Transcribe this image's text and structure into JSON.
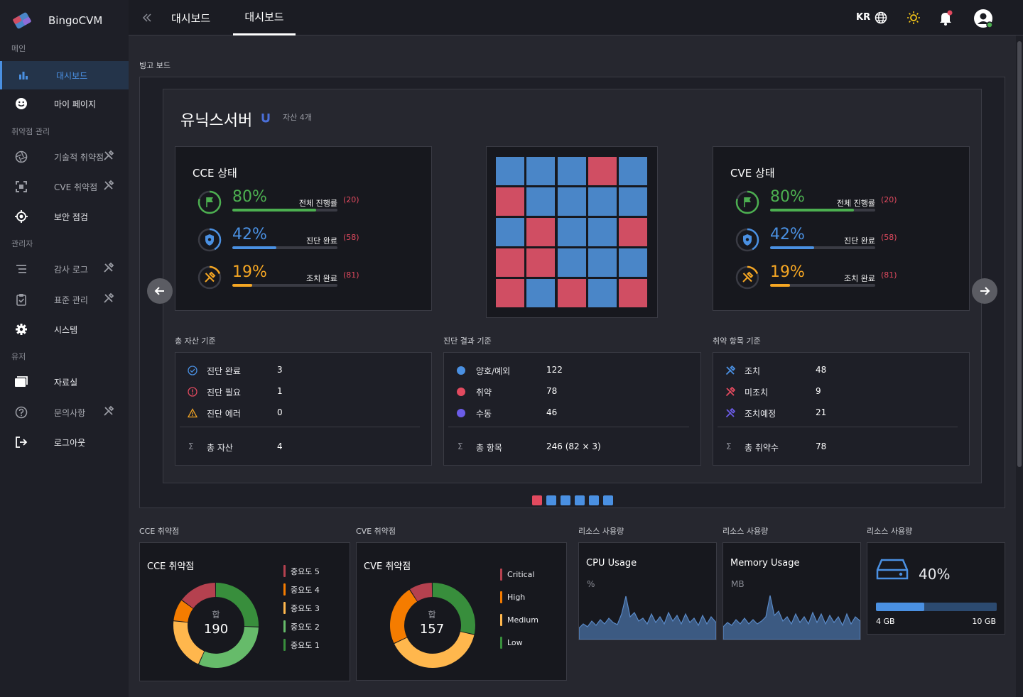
{
  "app": {
    "name": "BingoCVM"
  },
  "sidebar": {
    "sections": [
      "메인",
      "취약점 관리",
      "관리자",
      "유저"
    ],
    "items": [
      {
        "label": "대시보드",
        "icon": "bar-chart-icon"
      },
      {
        "label": "마이 페이지",
        "icon": "smile-icon"
      },
      {
        "label": "기술적 취약점",
        "icon": "aperture-icon"
      },
      {
        "label": "CVE 취약점",
        "icon": "frame-icon"
      },
      {
        "label": "보안 점검",
        "icon": "target-icon"
      },
      {
        "label": "감사 로그",
        "icon": "list-icon"
      },
      {
        "label": "표준 관리",
        "icon": "clipboard-check-icon"
      },
      {
        "label": "시스템",
        "icon": "gear-icon"
      },
      {
        "label": "자료실",
        "icon": "folder-icon"
      },
      {
        "label": "문의사항",
        "icon": "question-icon"
      },
      {
        "label": "로그아웃",
        "icon": "logout-icon"
      }
    ]
  },
  "topbar": {
    "tabs": [
      "대시보드",
      "대시보드"
    ],
    "lang": "KR"
  },
  "bingo": {
    "section_title": "빙고 보드",
    "server_title": "유닉스서버",
    "asset_count": "자산 4개",
    "cce": {
      "title": "CCE 상태",
      "rows": [
        {
          "pct": "80%",
          "label": "전체 진행률",
          "count": "(20)",
          "value": 80,
          "color": "#4caf50"
        },
        {
          "pct": "42%",
          "label": "진단 완료",
          "count": "(58)",
          "value": 42,
          "color": "#4a90e2"
        },
        {
          "pct": "19%",
          "label": "조치 완료",
          "count": "(81)",
          "value": 19,
          "color": "#f5a623"
        }
      ]
    },
    "cve": {
      "title": "CVE 상태",
      "rows": [
        {
          "pct": "80%",
          "label": "전체 진행률",
          "count": "(20)",
          "value": 80,
          "color": "#4caf50"
        },
        {
          "pct": "42%",
          "label": "진단 완료",
          "count": "(58)",
          "value": 42,
          "color": "#4a90e2"
        },
        {
          "pct": "19%",
          "label": "조치 완료",
          "count": "(81)",
          "value": 19,
          "color": "#f5a623"
        }
      ]
    },
    "grid": [
      [
        "b",
        "b",
        "b",
        "r",
        "b"
      ],
      [
        "r",
        "b",
        "b",
        "b",
        "b"
      ],
      [
        "b",
        "r",
        "b",
        "b",
        "r"
      ],
      [
        "r",
        "r",
        "b",
        "b",
        "b"
      ],
      [
        "r",
        "b",
        "r",
        "b",
        "r"
      ]
    ],
    "summaries": [
      {
        "title": "총 자산 기준",
        "rows": [
          {
            "label": "진단 완료",
            "value": "3",
            "icon": "check-circle-icon"
          },
          {
            "label": "진단 필요",
            "value": "1",
            "icon": "alert-circle-icon"
          },
          {
            "label": "진단 에러",
            "value": "0",
            "icon": "warning-triangle-icon"
          }
        ],
        "total": {
          "label": "총 자산",
          "value": "4"
        }
      },
      {
        "title": "진단 결과 기준",
        "rows": [
          {
            "label": "양호/예외",
            "value": "122",
            "icon": "blue-dot-icon"
          },
          {
            "label": "취약",
            "value": "78",
            "icon": "red-dot-icon"
          },
          {
            "label": "수동",
            "value": "46",
            "icon": "purple-dot-icon"
          }
        ],
        "total": {
          "label": "총 항목",
          "value": "246 (82 × 3)"
        }
      },
      {
        "title": "취약 항목 기준",
        "rows": [
          {
            "label": "조치",
            "value": "48",
            "icon": "tools-blue-icon"
          },
          {
            "label": "미조치",
            "value": "9",
            "icon": "tools-red-icon"
          },
          {
            "label": "조치예정",
            "value": "21",
            "icon": "tools-purple-icon"
          }
        ],
        "total": {
          "label": "총 취약수",
          "value": "78"
        }
      }
    ]
  },
  "bottom": {
    "cce": {
      "section": "CCE 취약점",
      "title": "CCE 취약점",
      "total_label": "합",
      "total": "190",
      "legend": [
        {
          "label": "중요도 5",
          "color": "#b5414f"
        },
        {
          "label": "중요도 4",
          "color": "#f57c00"
        },
        {
          "label": "중요도 3",
          "color": "#ffb74d"
        },
        {
          "label": "중요도 2",
          "color": "#66bb6a"
        },
        {
          "label": "중요도 1",
          "color": "#388e3c"
        }
      ]
    },
    "cve": {
      "section": "CVE 취약점",
      "title": "CVE 취약점",
      "total_label": "합",
      "total": "157",
      "legend": [
        {
          "label": "Critical",
          "color": "#b5414f"
        },
        {
          "label": "High",
          "color": "#f57c00"
        },
        {
          "label": "Medium",
          "color": "#ffb74d"
        },
        {
          "label": "Low",
          "color": "#388e3c"
        }
      ]
    },
    "cpu": {
      "section": "리소스 사용량",
      "title": "CPU Usage",
      "unit": "%"
    },
    "memory": {
      "section": "리소스 사용량",
      "title": "Memory Usage",
      "unit": "MB"
    },
    "disk": {
      "section": "리소스 사용량",
      "pct": "40%",
      "used": "4 GB",
      "total": "10 GB",
      "value": 40
    }
  },
  "chart_data": [
    {
      "type": "pie",
      "title": "CCE 취약점",
      "categories": [
        "중요도 5",
        "중요도 4",
        "중요도 3",
        "중요도 2",
        "중요도 1"
      ],
      "values": [
        28,
        16,
        38,
        59,
        49
      ]
    },
    {
      "type": "pie",
      "title": "CVE 취약점",
      "categories": [
        "Critical",
        "High",
        "Medium",
        "Low"
      ],
      "values": [
        14,
        36,
        62,
        45
      ]
    }
  ],
  "colors": {
    "blue": "#4a86c8",
    "red": "#d04e63",
    "accent": "#4a90e2"
  }
}
